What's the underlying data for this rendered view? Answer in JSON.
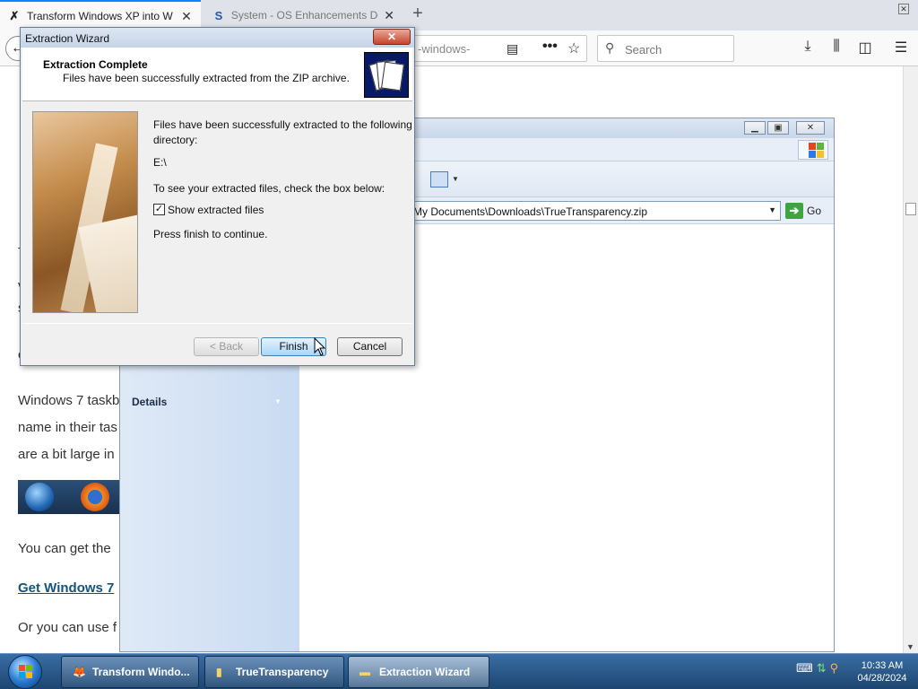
{
  "browser": {
    "tabs": [
      {
        "title": "Transform Windows XP into W",
        "active": true
      },
      {
        "title": "System - OS Enhancements De",
        "active": false
      }
    ],
    "url_fragment": "-windows-",
    "search_placeholder": "Search"
  },
  "page": {
    "paragraphs": [
      "Windows 7 taskb",
      "name in their tas",
      "are a bit large in",
      "You can get the"
    ],
    "link_text": "Get Windows 7",
    "trailing_text": "Or you can use f",
    "stray_letters": [
      "T",
      "v",
      "s",
      "c"
    ]
  },
  "explorer": {
    "address": "My Documents\\Downloads\\TrueTransparency.zip",
    "go_label": "Go",
    "side_section": "Details"
  },
  "wizard": {
    "window_title": "Extraction Wizard",
    "header_title": "Extraction Complete",
    "header_subtitle": "Files have been successfully extracted from the ZIP archive.",
    "line1": "Files have been successfully extracted to the following",
    "line2": "directory:",
    "directory": "E:\\",
    "instruction": "To see your extracted files, check the box below:",
    "checkbox_label": "Show extracted files",
    "checkbox_checked": true,
    "continue_text": "Press finish to continue.",
    "back_label": "< Back",
    "finish_label": "Finish",
    "cancel_label": "Cancel"
  },
  "taskbar": {
    "buttons": [
      {
        "label": "Transform Windo...",
        "icon": "firefox-icon"
      },
      {
        "label": "TrueTransparency",
        "icon": "zip-folder-icon"
      },
      {
        "label": "Extraction Wizard",
        "icon": "folder-icon",
        "active": true
      }
    ],
    "time": "10:33 AM",
    "date": "04/28/2024"
  }
}
